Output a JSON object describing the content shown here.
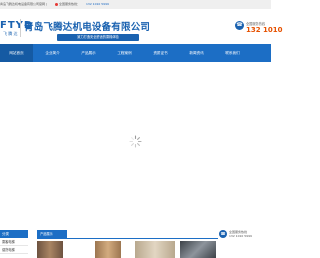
{
  "topbar": {
    "welcome": "青岛飞腾达机电设备有限公司官网 | ",
    "phone_text": "全国服务热线：",
    "link_text": "132 1010 5999"
  },
  "header": {
    "logo_mark": "FTYD",
    "logo_sub": "飞 腾 达",
    "company_name": "青岛飞腾达机电设备有限公司",
    "slogan": "致力打造安全舒适的乘梯体验",
    "hotline_label": "全国服务热线",
    "hotline_number": "132 1010"
  },
  "nav": {
    "items": [
      {
        "label": "网站首页"
      },
      {
        "label": "企业简介"
      },
      {
        "label": "产品展示"
      },
      {
        "label": "工程案例"
      },
      {
        "label": "资质证书"
      },
      {
        "label": "新闻资讯"
      },
      {
        "label": "联系我们"
      }
    ]
  },
  "sidebar": {
    "title": "分类",
    "items": [
      {
        "label": "乘客电梯"
      },
      {
        "label": "载货电梯"
      }
    ]
  },
  "products": {
    "tab_label": "产品展示",
    "thumbs": [
      {
        "name": "elevator-car-1",
        "color": "#8a6a52"
      },
      {
        "name": "elevator-car-2",
        "color": "#b5895f"
      },
      {
        "name": "elevator-car-3",
        "color": "#c9b79c"
      },
      {
        "name": "escalator",
        "color": "#5a5f66"
      }
    ]
  },
  "contact": {
    "line1": "全国服务热线",
    "line2": "132 1010 5999"
  },
  "colors": {
    "brand_blue": "#1c6ec5",
    "accent_orange": "#e65100"
  }
}
